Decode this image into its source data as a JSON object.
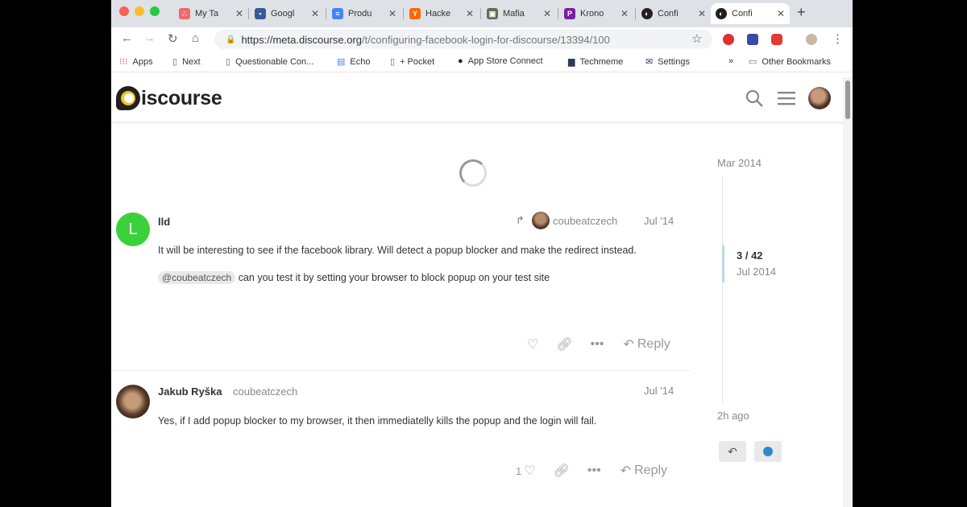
{
  "browser": {
    "tabs": [
      {
        "title": "My Ta",
        "favicon": "asana-icon",
        "color": "#f06a6a",
        "active": false
      },
      {
        "title": "Googl",
        "favicon": "google-analytics-icon",
        "color": "#3b5998",
        "active": false
      },
      {
        "title": "Produ",
        "favicon": "google-docs-icon",
        "color": "#4285f4",
        "active": false
      },
      {
        "title": "Hacke",
        "favicon": "hacker-news-icon",
        "color": "#ff6600",
        "active": false
      },
      {
        "title": "Mafia",
        "favicon": "image-icon",
        "color": "#6b6b55",
        "active": false
      },
      {
        "title": "Krono",
        "favicon": "kronos-icon",
        "color": "#7a1fa2",
        "active": false
      },
      {
        "title": "Confi",
        "favicon": "discourse-icon",
        "color": "#231f20",
        "active": false
      },
      {
        "title": "Confi",
        "favicon": "discourse-icon",
        "color": "#231f20",
        "active": true
      }
    ],
    "url": {
      "host": "https://meta.discourse.org",
      "path": "/t/configuring-facebook-login-for-discourse/13394/100"
    },
    "bookmarks": [
      {
        "label": "Apps",
        "icon": "apps-grid-icon"
      },
      {
        "label": "Next",
        "icon": "page-icon"
      },
      {
        "label": "Questionable Con...",
        "icon": "page-icon"
      },
      {
        "label": "Echo",
        "icon": "docs-icon"
      },
      {
        "label": "+ Pocket",
        "icon": "page-icon"
      },
      {
        "label": "App Store Connect",
        "icon": "apple-icon"
      },
      {
        "label": "Techmeme",
        "icon": "techmeme-icon"
      },
      {
        "label": "Settings",
        "icon": "mail-icon"
      },
      {
        "label": "Other Bookmarks",
        "icon": "folder-icon"
      }
    ],
    "more_bookmarks": "»"
  },
  "site": {
    "logo_text": "iscourse"
  },
  "posts": [
    {
      "username": "lld",
      "avatar_letter": "L",
      "avatar_color": "#3bd13b",
      "reply_to": "coubeatczech",
      "date": "Jul '14",
      "paragraphs": [
        "It will be interesting to see if the facebook library. Will detect a popup blocker and make the redirect instead."
      ],
      "mention": "@coubeatczech",
      "mention_text": "can you test it by setting your browser to block popup on your test site",
      "reply_label": "Reply"
    },
    {
      "username": "Jakub Ryška",
      "handle": "coubeatczech",
      "date": "Jul '14",
      "paragraphs": [
        "Yes, if I add popup blocker to my browser, it then immediatelly kills the popup and the login will fail."
      ],
      "like_count": "1",
      "reply_label": "Reply"
    }
  ],
  "timeline": {
    "start": "Mar 2014",
    "position": "3 / 42",
    "position_date": "Jul 2014",
    "end": "2h ago"
  }
}
